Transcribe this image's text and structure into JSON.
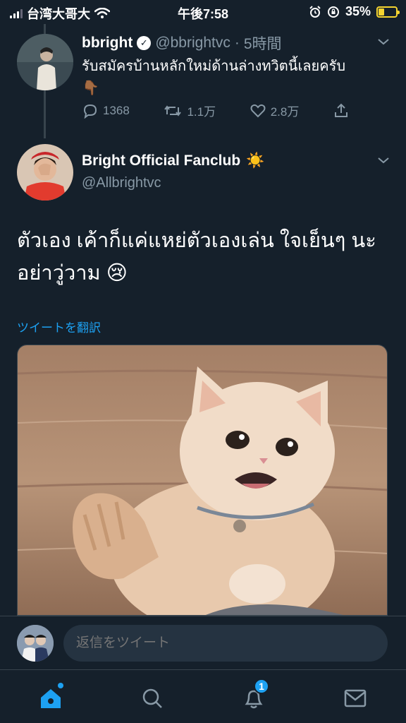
{
  "status_bar": {
    "carrier": "台湾大哥大",
    "time": "午後7:58",
    "battery": "35%"
  },
  "tweet_parent": {
    "name": "bbright",
    "handle": "@bbrightvc",
    "separator": "·",
    "time_ago": "5時間",
    "text": "รับสมัครบ้านหลักใหม่ด้านล่างทวิตนี้เลยครับ",
    "emoji": "👇🏾",
    "replies": "1368",
    "retweets": "1.1万",
    "likes": "2.8万"
  },
  "tweet_main": {
    "name": "Bright Official Fanclub",
    "name_emoji": "☀️",
    "handle": "@Allbrightvc",
    "text": "ตัวเอง เค้าก็แค่แหย่ตัวเองเล่น ใจเย็นๆ นะ อย่าวู่วาม 😢",
    "translate_link": "ツイートを翻訳"
  },
  "reply": {
    "placeholder": "返信をツイート"
  },
  "tabbar": {
    "notifications_badge": "1"
  },
  "colors": {
    "background": "#15202b",
    "accent": "#1da1f2",
    "muted": "#8899a6",
    "battery": "#f5d430"
  }
}
